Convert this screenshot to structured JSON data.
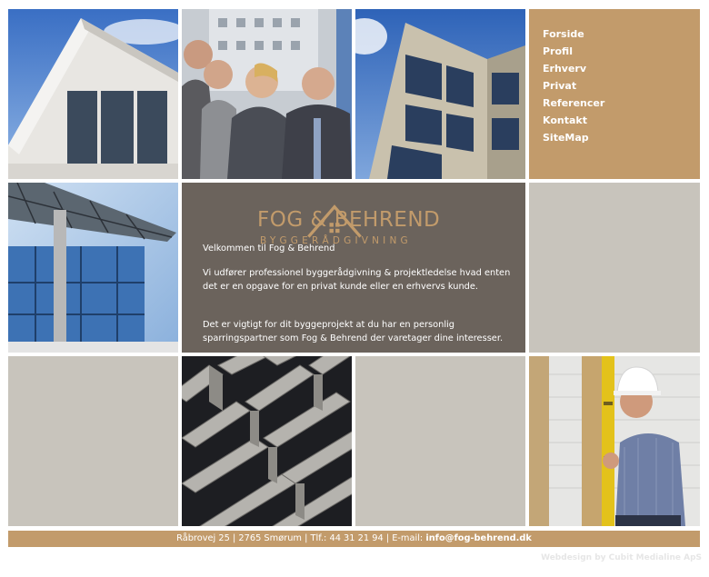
{
  "nav": {
    "items": [
      {
        "label": "Forside"
      },
      {
        "label": "Profil"
      },
      {
        "label": "Erhverv"
      },
      {
        "label": "Privat"
      },
      {
        "label": "Referencer"
      },
      {
        "label": "Kontakt"
      },
      {
        "label": "SiteMap"
      }
    ]
  },
  "logo": {
    "name": "FOG & BEHREND",
    "subtitle": "BYGGERÅDGIVNING"
  },
  "content": {
    "welcome": "Velkommen til Fog & Behrend",
    "para1": "Vi udfører professionel byggerådgivning & projektledelse hvad enten det er en opgave for en privat kunde eller en erhvervs kunde.",
    "para2": "Det er vigtigt for dit byggeprojekt at du har en personlig sparringspartner som Fog & Behrend der varetager dine interesser."
  },
  "footer": {
    "address": "Råbrovej 25 | 2765 Smørum | Tlf.: 44 31 21 94 | E-mail: ",
    "email": "info@fog-behrend.dk"
  },
  "credit": "Webdesign by Cubit Medialine ApS",
  "colors": {
    "brand_tan": "#c29b6b",
    "content_bg": "#6b635c",
    "beige_tile": "#c8c4bc"
  }
}
